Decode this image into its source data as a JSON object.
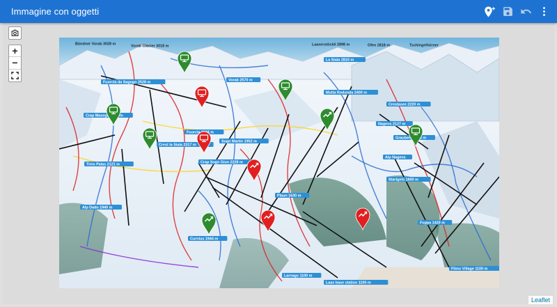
{
  "app": {
    "title": "Immagine con oggetti",
    "icons": [
      "add-location-icon",
      "save-icon",
      "undo-icon",
      "more-vert-icon"
    ]
  },
  "map": {
    "controls": {
      "screenshot_icon": "camera-icon",
      "zoom_in": "+",
      "zoom_out": "−",
      "fullscreen_icon": "fullscreen-icon"
    },
    "attribution": "Leaflet",
    "labels": [
      "Bündner Vorab 3028 m",
      "Vorab Glacier 3018 m",
      "Laaxerstöckli 2898 m",
      "Ofen 2818 m",
      "Tschingelhörner",
      "La Siala 2810 m",
      "Crap Masegn 2477 m",
      "Fuorcla da Sagogn 2528 m",
      "Vorab 2570 m",
      "Mutta Rodunda 2400 m",
      "Crestasee 2220 m",
      "Foppa 1420 m",
      "Startgels 1600 m",
      "Crap Sogn Gion 2228 m",
      "Sogn Martin 1952 m",
      "Fuorcla 2118 m",
      "Curnius 1944 m",
      "Alp Dado 1940 m",
      "Larnags 1100 m",
      "Laax base station 1100 m",
      "Flims Village 1100 m",
      "Alp Nagens",
      "Nagens 2127 m",
      "Crest la Siala 2317 m",
      "Plaun 1630 m",
      "Treis Palas 2121 m",
      "Grauberg 2228 m"
    ],
    "markers": [
      {
        "kind": "webcam",
        "color": "#2e8b2e"
      },
      {
        "kind": "webcam",
        "color": "#2e8b2e"
      },
      {
        "kind": "webcam",
        "color": "#2e8b2e"
      },
      {
        "kind": "webcam",
        "color": "#2e8b2e"
      },
      {
        "kind": "webcam",
        "color": "#2e8b2e"
      },
      {
        "kind": "webcam",
        "color": "#e02020"
      },
      {
        "kind": "webcam",
        "color": "#e02020"
      },
      {
        "kind": "trend",
        "color": "#2e8b2e"
      },
      {
        "kind": "trend",
        "color": "#2e8b2e"
      },
      {
        "kind": "trend",
        "color": "#e02020"
      },
      {
        "kind": "trend",
        "color": "#e02020"
      },
      {
        "kind": "trend",
        "color": "#e02020"
      }
    ],
    "colors": {
      "appbar": "#1e73d2",
      "marker_green": "#2e8b2e",
      "marker_red": "#e02020",
      "label_bg": "#2d8fd5"
    }
  }
}
